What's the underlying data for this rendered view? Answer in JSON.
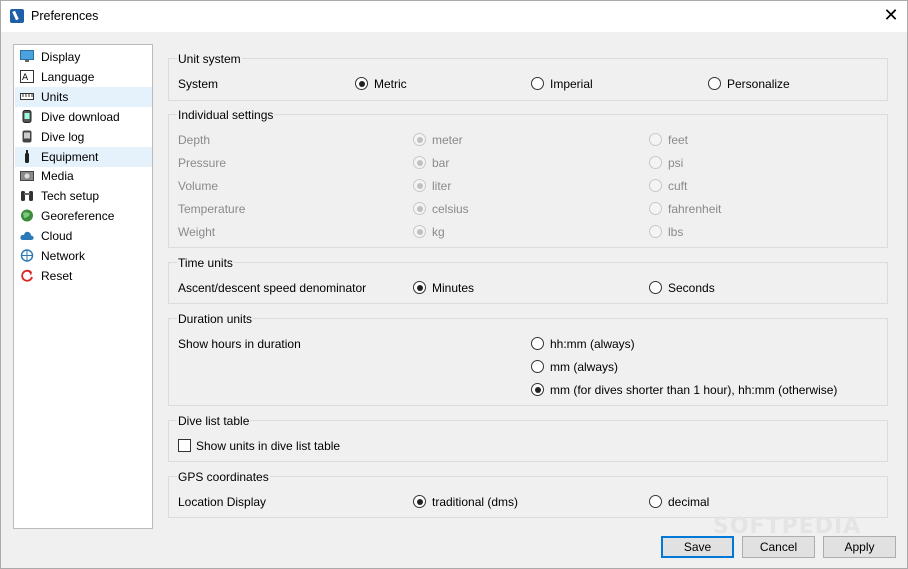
{
  "window": {
    "title": "Preferences"
  },
  "sidebar": {
    "items": [
      {
        "label": "Display",
        "icon": "monitor-icon"
      },
      {
        "label": "Language",
        "icon": "language-icon"
      },
      {
        "label": "Units",
        "icon": "ruler-icon",
        "selected": true
      },
      {
        "label": "Dive download",
        "icon": "dive-computer-icon"
      },
      {
        "label": "Dive log",
        "icon": "dive-log-icon"
      },
      {
        "label": "Equipment",
        "icon": "tank-icon",
        "hovered": true
      },
      {
        "label": "Media",
        "icon": "media-icon"
      },
      {
        "label": "Tech setup",
        "icon": "tech-setup-icon"
      },
      {
        "label": "Georeference",
        "icon": "globe-icon"
      },
      {
        "label": "Cloud",
        "icon": "cloud-icon"
      },
      {
        "label": "Network",
        "icon": "network-icon"
      },
      {
        "label": "Reset",
        "icon": "reset-icon"
      }
    ]
  },
  "unit_system": {
    "title": "Unit system",
    "label": "System",
    "options": [
      "Metric",
      "Imperial",
      "Personalize"
    ],
    "selected": "Metric"
  },
  "individual": {
    "title": "Individual settings",
    "rows": [
      {
        "label": "Depth",
        "metric": "meter",
        "imperial": "feet"
      },
      {
        "label": "Pressure",
        "metric": "bar",
        "imperial": "psi"
      },
      {
        "label": "Volume",
        "metric": "liter",
        "imperial": "cuft"
      },
      {
        "label": "Temperature",
        "metric": "celsius",
        "imperial": "fahrenheit"
      },
      {
        "label": "Weight",
        "metric": "kg",
        "imperial": "lbs"
      }
    ]
  },
  "time_units": {
    "title": "Time units",
    "label": "Ascent/descent speed denominator",
    "options": [
      "Minutes",
      "Seconds"
    ],
    "selected": "Minutes"
  },
  "duration_units": {
    "title": "Duration units",
    "label": "Show hours in duration",
    "options": [
      "hh:mm (always)",
      "mm (always)",
      "mm (for dives shorter than 1 hour), hh:mm (otherwise)"
    ],
    "selected": "mm (for dives shorter than 1 hour), hh:mm (otherwise)"
  },
  "dive_list": {
    "title": "Dive list table",
    "checkbox_label": "Show units in dive list table",
    "checked": false
  },
  "gps": {
    "title": "GPS coordinates",
    "label": "Location Display",
    "options": [
      "traditional (dms)",
      "decimal"
    ],
    "selected": "traditional (dms)"
  },
  "buttons": {
    "save": "Save",
    "cancel": "Cancel",
    "apply": "Apply"
  },
  "watermark": "SOFTPEDIA",
  "colors": {
    "accent": "#0078d7",
    "selection": "#e5f1fb",
    "disabled_text": "#8a8a8a"
  }
}
